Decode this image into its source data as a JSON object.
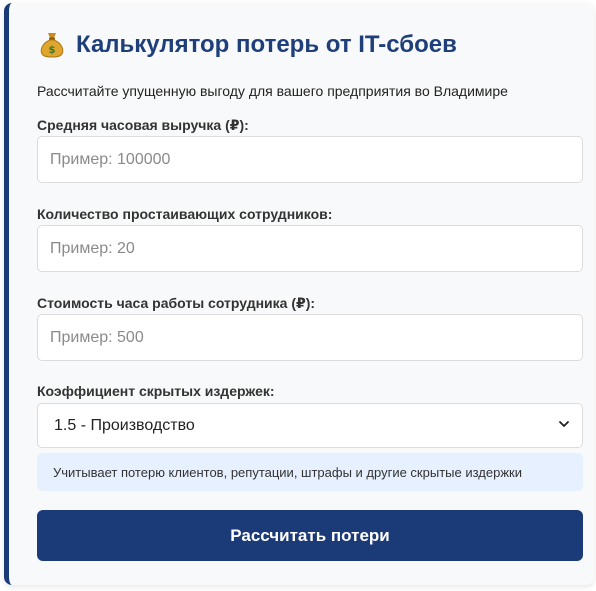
{
  "header": {
    "icon": "money-bag-icon",
    "title": "Калькулятор потерь от IT-сбоев",
    "subtitle": "Рассчитайте упущенную выгоду для вашего предприятия во Владимире"
  },
  "form": {
    "revenue": {
      "label": "Средняя часовая выручка (₽):",
      "placeholder": "Пример: 100000",
      "value": ""
    },
    "employees": {
      "label": "Количество простаивающих сотрудников:",
      "placeholder": "Пример: 20",
      "value": ""
    },
    "hourly_cost": {
      "label": "Стоимость часа работы сотрудника (₽):",
      "placeholder": "Пример: 500",
      "value": ""
    },
    "coefficient": {
      "label": "Коэффициент скрытых издержек:",
      "selected": "1.5 - Производство",
      "hint": "Учитывает потерю клиентов, репутации, штрафы и другие скрытые издержки"
    },
    "submit_label": "Рассчитать потери"
  },
  "colors": {
    "accent": "#1b3a78",
    "title": "#1f3f7a",
    "hint_bg": "#e7f0fe",
    "card_bg": "#f8f9fa"
  }
}
